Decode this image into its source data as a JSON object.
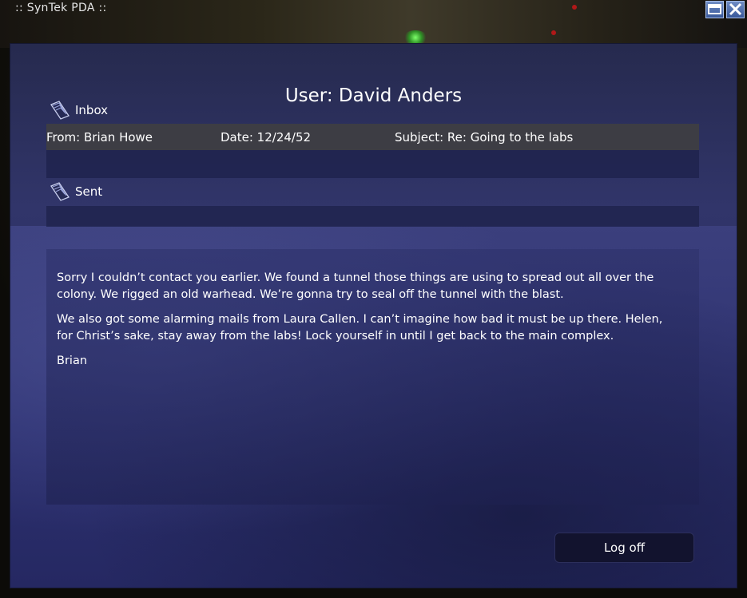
{
  "window": {
    "title": ":: SynTek PDA ::",
    "buttons": [
      {
        "name": "minimize-button",
        "icon": "minimize-icon"
      },
      {
        "name": "close-button",
        "icon": "close-icon"
      }
    ]
  },
  "header": {
    "user_title": "User: David Anders"
  },
  "inbox": {
    "label": "Inbox",
    "icon": "folder-icon",
    "messages": [
      {
        "from": "From: Brian Howe",
        "date": "Date: 12/24/52",
        "subject": "Subject: Re: Going to the labs"
      }
    ]
  },
  "sent": {
    "label": "Sent",
    "icon": "folder-icon",
    "messages": []
  },
  "message_body": {
    "paragraphs": [
      "Sorry I couldn’t contact you earlier.  We found a tunnel those things are using to spread out all over the colony.  We rigged an old warhead.  We’re gonna try to seal off the tunnel with the blast.",
      "We also got some alarming mails from Laura Callen.  I can’t imagine how bad it must be up there.  Helen, for Christ’s sake, stay away from the labs!  Lock yourself in until I get back to the main complex.",
      "Brian"
    ]
  },
  "footer": {
    "logoff_label": "Log off"
  },
  "colors": {
    "panel": "#2d3170",
    "selected_row": "#3d3d44",
    "text": "#ffffff",
    "button_bg": "#12132e"
  }
}
